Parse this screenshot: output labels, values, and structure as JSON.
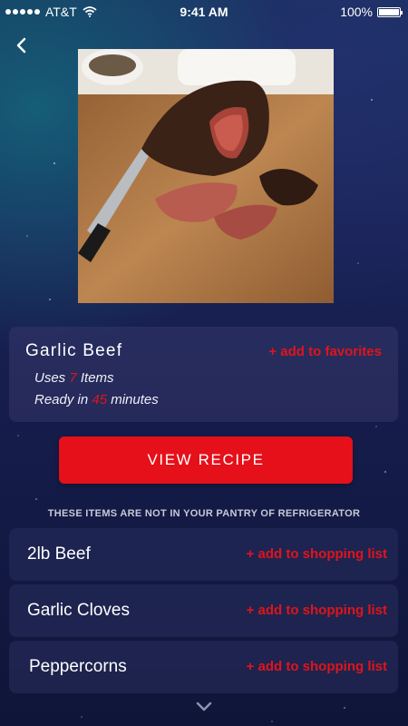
{
  "status_bar": {
    "carrier": "AT&T",
    "time": "9:41 AM",
    "battery": "100%"
  },
  "icons": {
    "back": "chevron-left-icon",
    "wifi": "wifi-icon",
    "battery": "battery-icon",
    "more": "chevron-down-icon"
  },
  "recipe": {
    "title": "Garlic Beef",
    "favorite_label": "+ add to favorites",
    "uses_prefix": "Uses",
    "uses_count": "7",
    "uses_suffix": "Items",
    "ready_prefix": "Ready in",
    "ready_minutes": "45",
    "ready_suffix": "minutes",
    "view_button": "VIEW RECIPE"
  },
  "missing_notice": "THESE ITEMS ARE NOT IN YOUR PANTRY OF REFRIGERATOR",
  "missing_items": [
    {
      "name": "2lb Beef",
      "action": "+ add to shopping list"
    },
    {
      "name": "Garlic Cloves",
      "action": "+ add to shopping list"
    },
    {
      "name": "Peppercorns",
      "action": "+ add to shopping list"
    }
  ],
  "colors": {
    "accent": "#e5101a",
    "background": "#1a2458"
  }
}
